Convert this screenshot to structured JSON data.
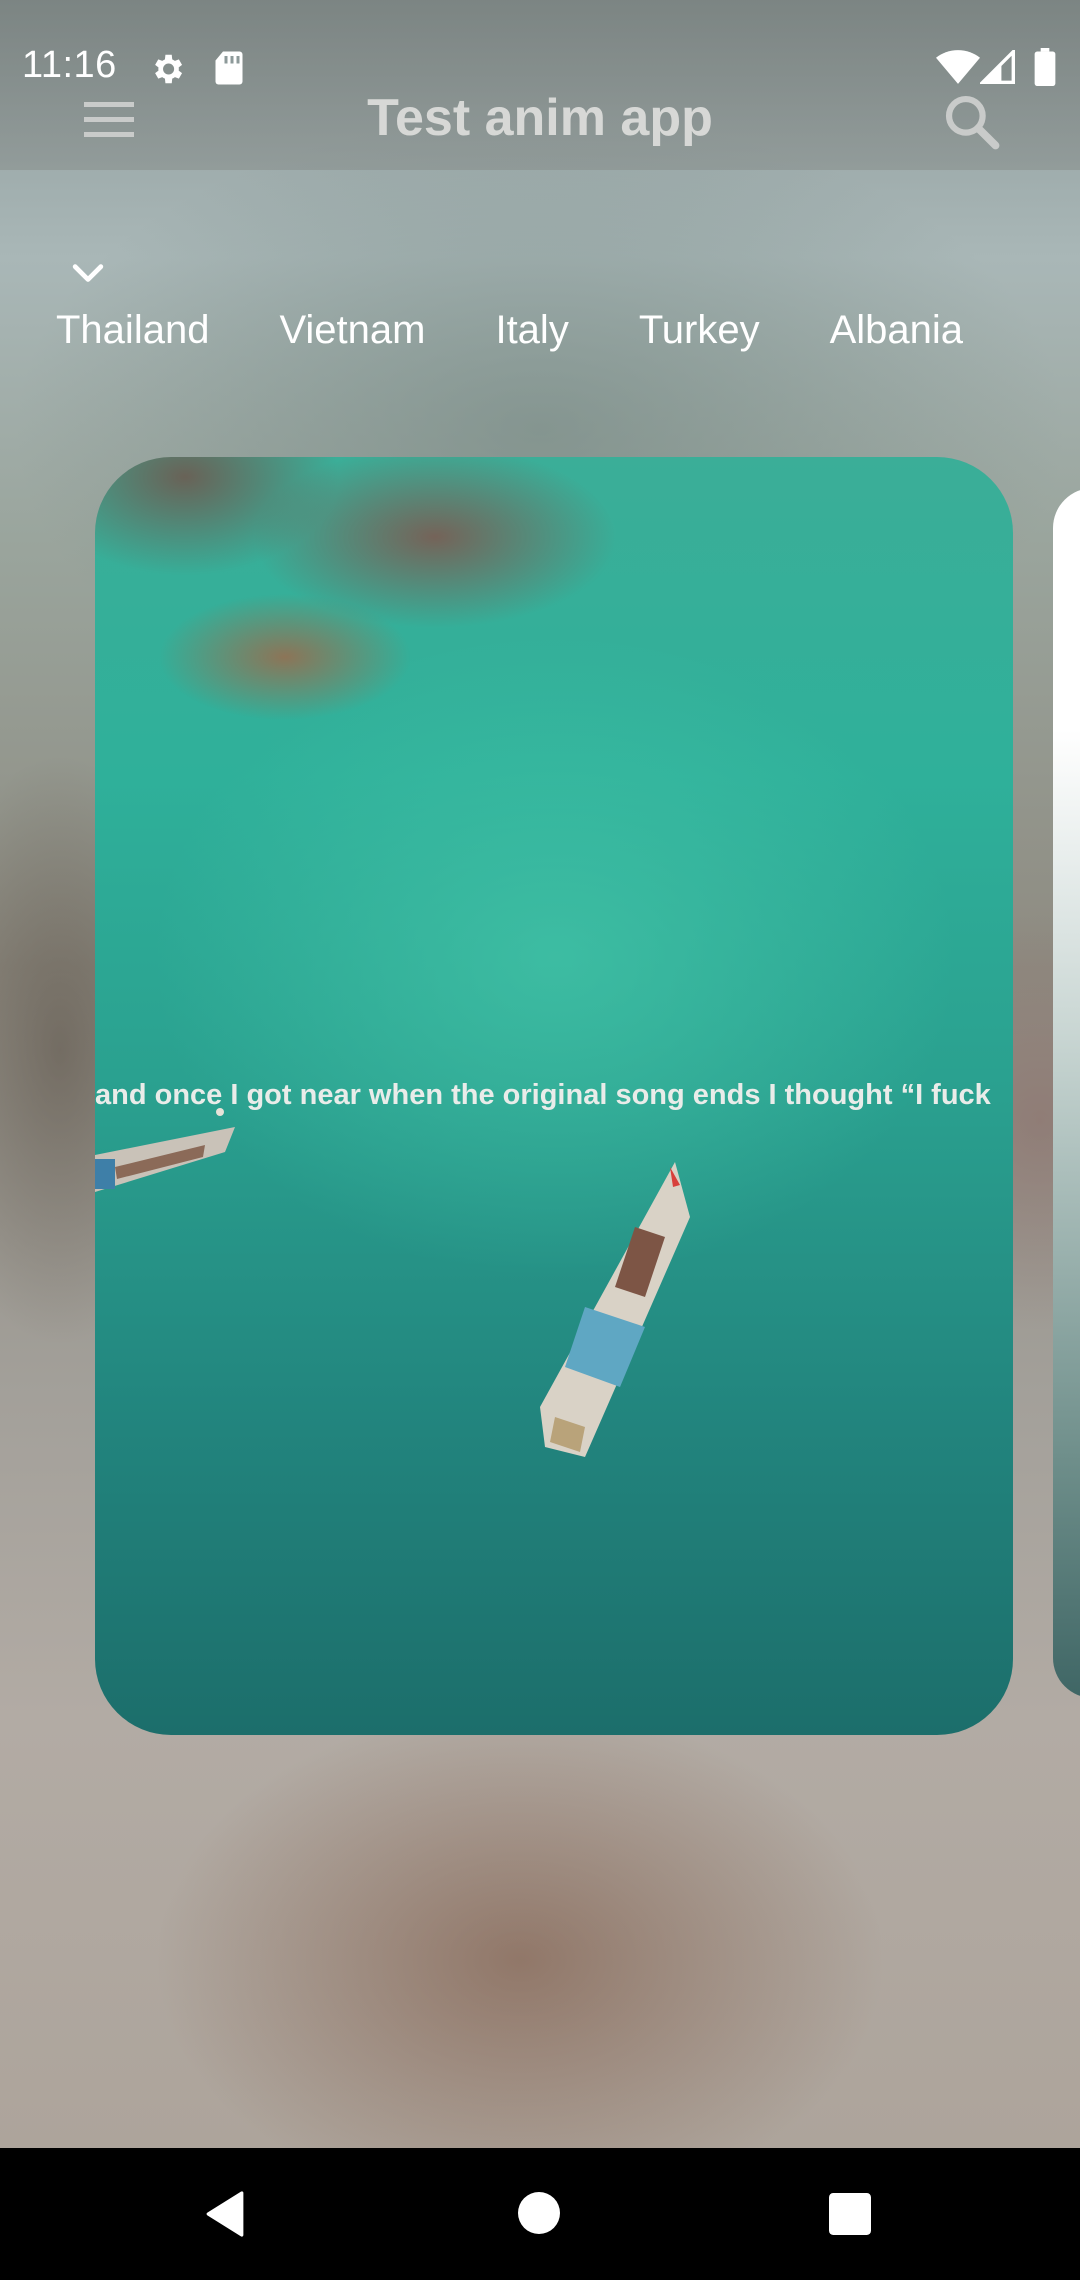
{
  "status_bar": {
    "time": "11:16",
    "left_icons": [
      "settings-icon",
      "sd-card-icon"
    ],
    "right_icons": [
      "wifi-icon",
      "signal-icon",
      "battery-icon"
    ]
  },
  "app_bar": {
    "title": "Test anim app",
    "menu_icon": "menu-icon",
    "search_icon": "search-icon"
  },
  "tabs": {
    "expand_icon": "chevron-down-icon",
    "items": [
      "Thailand",
      "Vietnam",
      "Italy",
      "Turkey",
      "Albania"
    ]
  },
  "card": {
    "caption": "and once I got near when the original song ends I thought “I fuck"
  },
  "nav_bar": {
    "buttons": [
      "back-icon",
      "home-icon",
      "recents-icon"
    ]
  },
  "colors": {
    "title": "#d7d8d6",
    "water": "#2fb09a",
    "nav_bar": "#000000"
  }
}
